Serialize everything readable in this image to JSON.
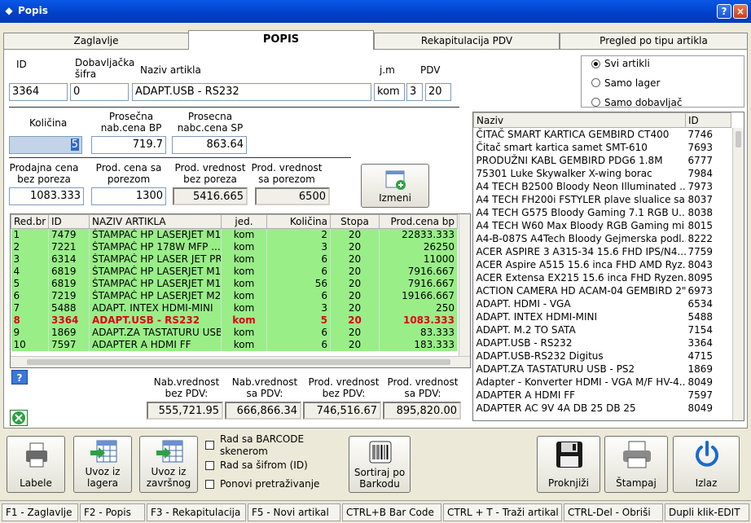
{
  "window": {
    "title": "Popis",
    "help_label": "?",
    "close_label": "×"
  },
  "tabs": [
    {
      "label": "Zaglavlje"
    },
    {
      "label": "POPIS"
    },
    {
      "label": "Rekapitulacija PDV"
    },
    {
      "label": "Pregled po tipu artikla"
    }
  ],
  "fields": {
    "id_label": "ID",
    "id_value": "3364",
    "dob_sifra_label": "Dobavljačka šifra",
    "dob_sifra_value": "0",
    "naziv_label": "Naziv artikla",
    "naziv_value": "ADAPT.USB - RS232",
    "jm_label": "j.m",
    "jm_value": "kom",
    "pdv_label": "PDV",
    "pdv_code": "3",
    "pdv_value": "20",
    "kolicina_label": "Količina",
    "kolicina_value": "5",
    "pros_bp_label": "Prosečna nab.cena BP",
    "pros_bp_value": "719.7",
    "pros_sp_label": "Prosecna nabc.cena SP",
    "pros_sp_value": "863.64",
    "prod_cena_bez_label": "Prodajna cena bez poreza",
    "prod_cena_bez_value": "1083.333",
    "prod_cena_sa_label": "Prod. cena sa porezom",
    "prod_cena_sa_value": "1300",
    "prod_vr_bez_label": "Prod. vrednost bez poreza",
    "prod_vr_bez_value": "5416.665",
    "prod_vr_sa_label": "Prod. vrednost sa porezom",
    "prod_vr_sa_value": "6500"
  },
  "buttons": {
    "izmeni": "Izmeni",
    "help": "?"
  },
  "filter": [
    {
      "label": "Svi artikli",
      "selected": true
    },
    {
      "label": "Samo lager",
      "selected": false
    },
    {
      "label": "Samo dobavljač",
      "selected": false
    }
  ],
  "grid": {
    "headers": [
      "Red.br",
      "ID",
      "NAZIV ARTIKLA",
      "jed.",
      "Količina",
      "Stopa",
      "Prod.cena bp"
    ],
    "rows": [
      [
        "1",
        "7479",
        "ŠTAMPAČ HP LASERJET M1...",
        "kom",
        "2",
        "20",
        "22833.333"
      ],
      [
        "2",
        "7221",
        "ŠTAMPAČ HP 178W MFP ...",
        "kom",
        "3",
        "20",
        "26250"
      ],
      [
        "3",
        "6314",
        "ŠTAMPAČ HP LASER JET PR...",
        "kom",
        "6",
        "20",
        "11000"
      ],
      [
        "4",
        "6819",
        "ŠTAMPAČ HP LASERJET M1...",
        "kom",
        "6",
        "20",
        "7916.667"
      ],
      [
        "5",
        "6819",
        "ŠTAMPAČ HP LASERJET M1...",
        "kom",
        "56",
        "20",
        "7916.667"
      ],
      [
        "6",
        "7219",
        "ŠTAMPAČ HP LASERJET M2...",
        "kom",
        "6",
        "20",
        "19166.667"
      ],
      [
        "7",
        "5488",
        "ADAPT. INTEX HDMI-MINI",
        "kom",
        "3",
        "20",
        "250"
      ],
      [
        "8",
        "3364",
        "ADAPT.USB - RS232",
        "kom",
        "5",
        "20",
        "1083.333"
      ],
      [
        "9",
        "1869",
        "ADAPT.ZA TASTATURU USB ...",
        "kom",
        "6",
        "20",
        "83.333"
      ],
      [
        "10",
        "7597",
        "ADAPTER A HDMI FF",
        "kom",
        "6",
        "20",
        "183.333"
      ]
    ],
    "selected_index": 7
  },
  "list": {
    "headers": [
      "Naziv",
      "ID"
    ],
    "rows": [
      [
        "ČITAČ SMART KARTICA GEMBIRD CT400",
        "7746"
      ],
      [
        "Čitač smart kartica samet SMT-610",
        "7693"
      ],
      [
        "PRODUŽNI KABL GEMBIRD PDG6 1.8M",
        "6777"
      ],
      [
        "75301 Luke Skywalker X-wing borac",
        "7984"
      ],
      [
        "A4 TECH B2500 Bloody Neon Illuminated ...",
        "7973"
      ],
      [
        "A4 TECH FH200i FSTYLER plave slualice sa...",
        "8037"
      ],
      [
        "A4 TECH G575 Bloody Gaming 7.1 RGB U...",
        "8038"
      ],
      [
        "A4 TECH W60 Max Bloody RGB Gaming mi",
        "8015"
      ],
      [
        "A4-B-087S A4Tech Bloody Gejmerska podl...",
        "8222"
      ],
      [
        "ACER ASPIRE 3 A315-34 15.6 FHD IPS/N4...",
        "7759"
      ],
      [
        "ACER Aspire A515 15.6 inca FHD AMD Ryz...",
        "8043"
      ],
      [
        "ACER Extensa EX215 15.6 inca FHD Ryzen...",
        "8095"
      ],
      [
        "ACTION CAMERA HD ACAM-04 GEMBIRD 2\"",
        "6973"
      ],
      [
        "ADAPT. HDMI - VGA",
        "6534"
      ],
      [
        "ADAPT. INTEX HDMI-MINI",
        "5488"
      ],
      [
        "ADAPT. M.2 TO SATA",
        "7154"
      ],
      [
        "ADAPT.USB - RS232",
        "3364"
      ],
      [
        "ADAPT.USB-RS232 Digitus",
        "4715"
      ],
      [
        "ADAPT.ZA TASTATURU USB - PS2",
        "1869"
      ],
      [
        "Adapter - Konverter HDMI - VGA M/F HV-4...",
        "8049"
      ],
      [
        "ADAPTER A HDMI FF",
        "7597"
      ],
      [
        "ADAPTER AC 9V 4A DB 25 DB 25",
        "8049"
      ]
    ]
  },
  "totals": {
    "nab_bez_label": "Nab.vrednost bez PDV:",
    "nab_bez_value": "555,721.95",
    "nab_sa_label": "Nab.vrednost sa PDV:",
    "nab_sa_value": "666,866.34",
    "prod_bez_label": "Prod. vrednost bez PDV:",
    "prod_bez_value": "746,516.67",
    "prod_sa_label": "Prod. vrednost sa PDV:",
    "prod_sa_value": "895,820.00"
  },
  "toolbar": {
    "labele": "Labele",
    "uvoz_lager": "Uvoz iz lagera",
    "uvoz_zavrsnog": "Uvoz iz završnog",
    "cb_barcode": "Rad sa BARCODE skenerom",
    "cb_sifra": "Rad sa šifrom (ID)",
    "cb_ponovi": "Ponovi pretraživanje",
    "sortiraj": "Sortiraj po Barkodu",
    "proknjizi": "Proknjiži",
    "stampaj": "Štampaj",
    "izlaz": "Izlaz"
  },
  "status": [
    "F1 - Zaglavlje",
    "F2 - Popis",
    "F3 - Rekapitulacija",
    "F5 - Novi artikal",
    "CTRL+B Bar Code",
    "CTRL + T - Traži artikal",
    "CTRL-Del - Obriši",
    "Dupli klik-EDIT"
  ]
}
